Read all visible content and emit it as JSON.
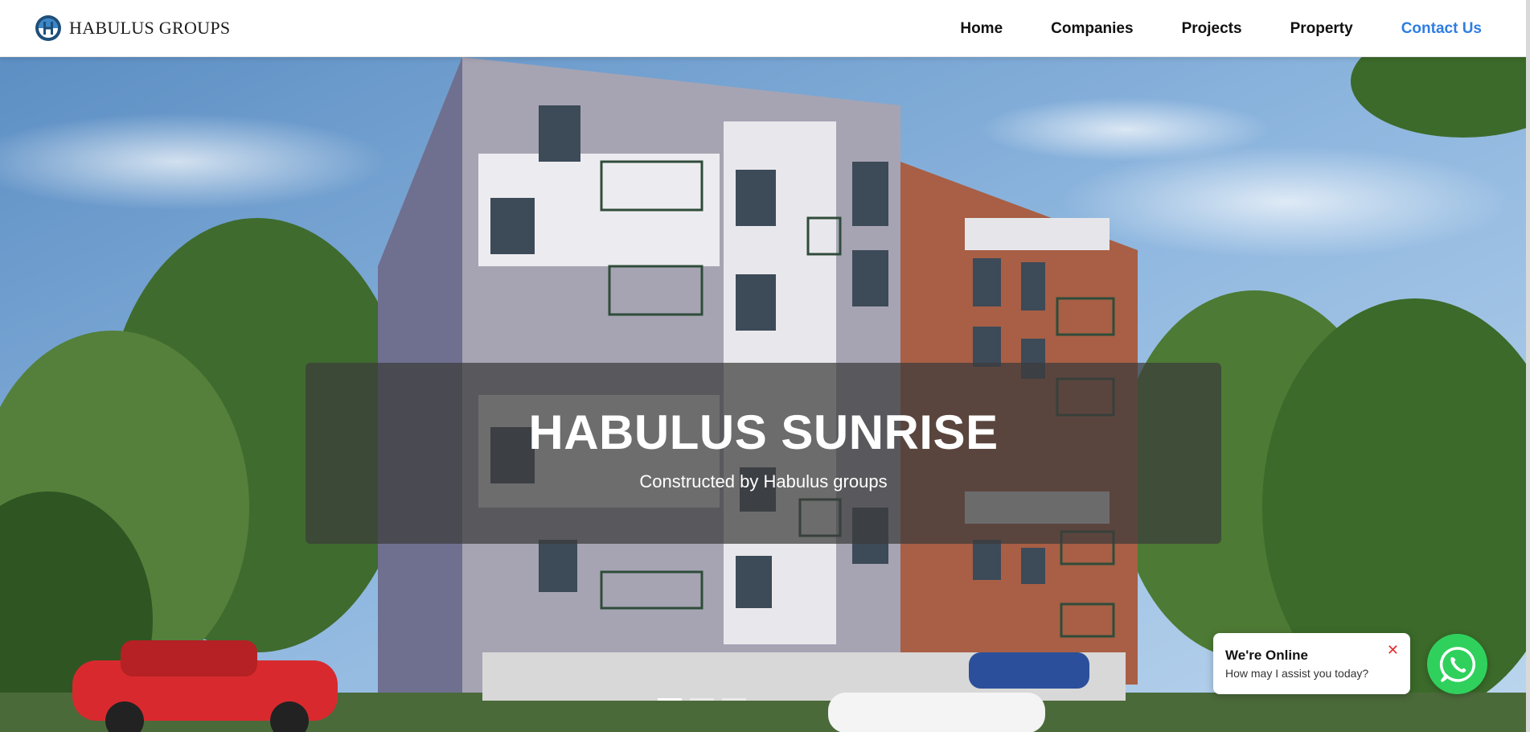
{
  "brand": {
    "name": "HABULUS GROUPS",
    "logo_icon": "habulus-logo-icon",
    "accent": "#2f7de1"
  },
  "nav": {
    "items": [
      {
        "label": "Home",
        "active": false
      },
      {
        "label": "Companies",
        "active": false
      },
      {
        "label": "Projects",
        "active": false
      },
      {
        "label": "Property",
        "active": false
      },
      {
        "label": "Contact Us",
        "active": true
      }
    ]
  },
  "hero": {
    "title": "HABULUS SUNRISE",
    "subtitle": "Constructed by Habulus groups",
    "slides_total": 3,
    "active_slide": 1
  },
  "chat": {
    "title": "We're Online",
    "message": "How may I assist you today?",
    "close_icon": "close-icon",
    "button_icon": "whatsapp-icon",
    "button_color": "#2fd15c"
  }
}
